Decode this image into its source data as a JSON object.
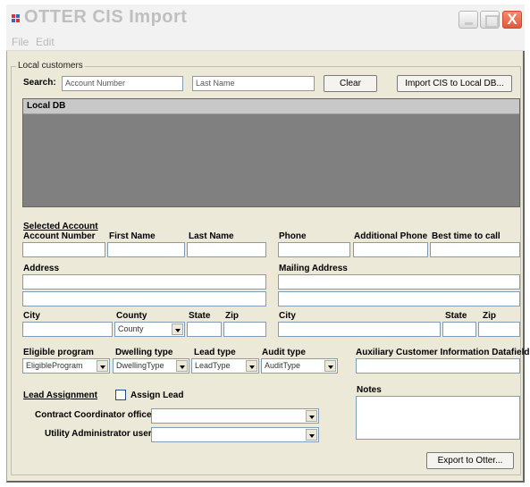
{
  "window": {
    "title": "OTTER CIS Import",
    "close_glyph": "X"
  },
  "menu": [
    "File",
    "Edit"
  ],
  "local_customers": {
    "legend": "Local customers",
    "search_label": "Search:",
    "account_number_value": "Account Number",
    "last_name_value": "Last Name",
    "clear_label": "Clear",
    "import_label": "Import CIS to Local DB..."
  },
  "local_db": {
    "header": "Local DB"
  },
  "selected_account": {
    "heading": "Selected Account",
    "account_number": "Account Number",
    "first_name": "First Name",
    "last_name": "Last Name",
    "phone": "Phone",
    "additional_phone": "Additional Phone",
    "best_time": "Best time to call",
    "address": "Address",
    "mailing_address": "Mailing Address",
    "city": "City",
    "county": "County",
    "county_value": "County",
    "state": "State",
    "zip": "Zip",
    "mailing_city": "City",
    "mailing_state": "State",
    "mailing_zip": "Zip"
  },
  "program": {
    "eligible_program": "Eligible program",
    "eligible_program_value": "EligibleProgram",
    "dwelling_type": "Dwelling type",
    "dwelling_type_value": "DwellingType",
    "lead_type": "Lead type",
    "lead_type_value": "LeadType",
    "audit_type": "Audit type",
    "audit_type_value": "AuditType",
    "auxiliary": "Auxiliary Customer Information Datafield"
  },
  "lead": {
    "heading": "Lead Assignment",
    "assign_lead": "Assign Lead",
    "contract_office": "Contract Coordinator office",
    "utility_admin": "Utility Administrator user",
    "notes": "Notes"
  },
  "export_label": "Export to Otter..."
}
